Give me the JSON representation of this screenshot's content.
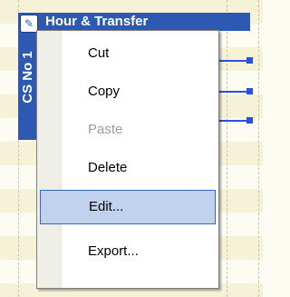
{
  "lane": {
    "header_text": "Hour & Transfer",
    "sidebar_text": "CS No 1"
  },
  "context_menu": {
    "items": [
      {
        "label": "Cut",
        "enabled": true
      },
      {
        "label": "Copy",
        "enabled": true
      },
      {
        "label": "Paste",
        "enabled": false
      },
      {
        "label": "Delete",
        "enabled": true
      },
      {
        "label": "Edit...",
        "enabled": true,
        "highlighted": true
      },
      {
        "label": "Export...",
        "enabled": true
      }
    ]
  },
  "colors": {
    "lane_blue": "#2e59b3",
    "connector_blue": "#2b4fe0",
    "highlight": "#c1d2ee",
    "highlight_border": "#316ac5",
    "disabled_text": "#9d9d9d"
  }
}
